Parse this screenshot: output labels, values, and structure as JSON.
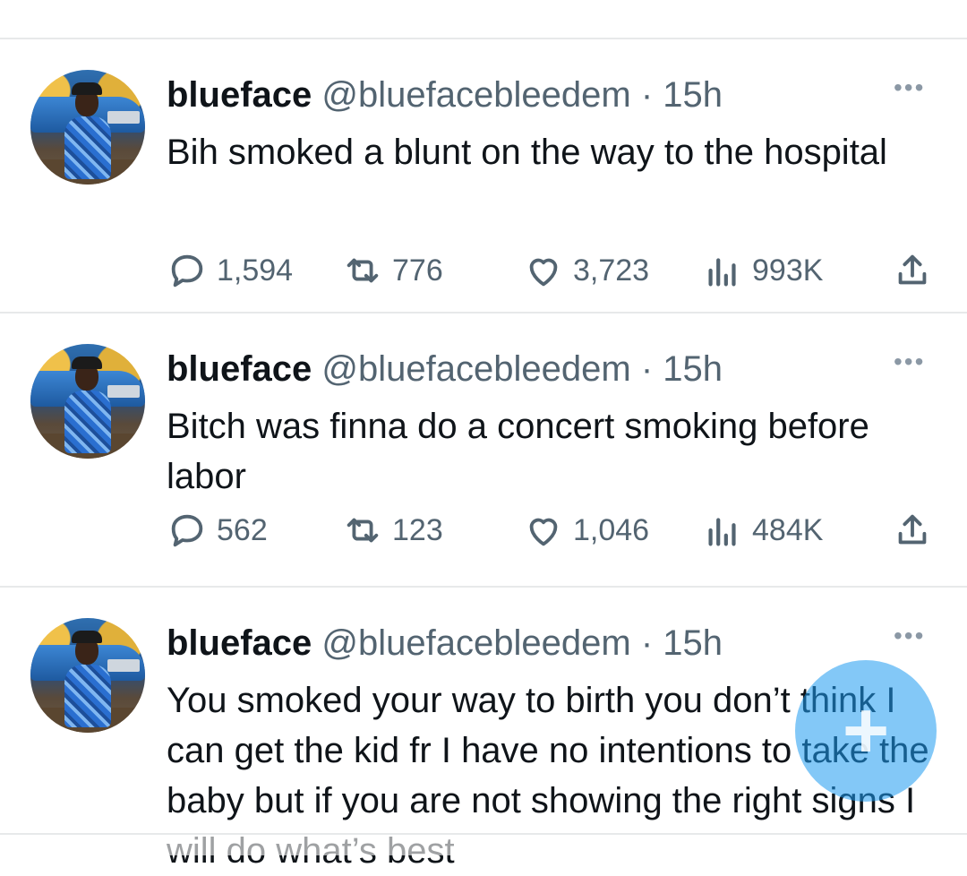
{
  "tweets": [
    {
      "name": "blueface",
      "handle": "@bluefacebleedem",
      "dot": "·",
      "time": "15h",
      "text": "Bih smoked a blunt on the way to the hospital",
      "replies": "1,594",
      "retweets": "776",
      "likes": "3,723",
      "views": "993K"
    },
    {
      "name": "blueface",
      "handle": "@bluefacebleedem",
      "dot": "·",
      "time": "15h",
      "text": "Bitch was finna do a concert smoking before labor",
      "replies": "562",
      "retweets": "123",
      "likes": "1,046",
      "views": "484K"
    },
    {
      "name": "blueface",
      "handle": "@bluefacebleedem",
      "dot": "·",
      "time": "15h",
      "text": "You smoked your way to birth you don’t think I can get the kid fr I have no intentions to take the baby but if you are not showing the right signs I will do what’s best"
    }
  ],
  "more_label": "•••",
  "fab_label": "+",
  "icons": {
    "reply": "reply-icon",
    "retweet": "retweet-icon",
    "like": "heart-icon",
    "views": "views-icon",
    "share": "share-icon"
  },
  "colors": {
    "text": "#0f1419",
    "secondary": "#536471",
    "divider": "#e7e9ea",
    "accent": "#1d9bf0"
  }
}
